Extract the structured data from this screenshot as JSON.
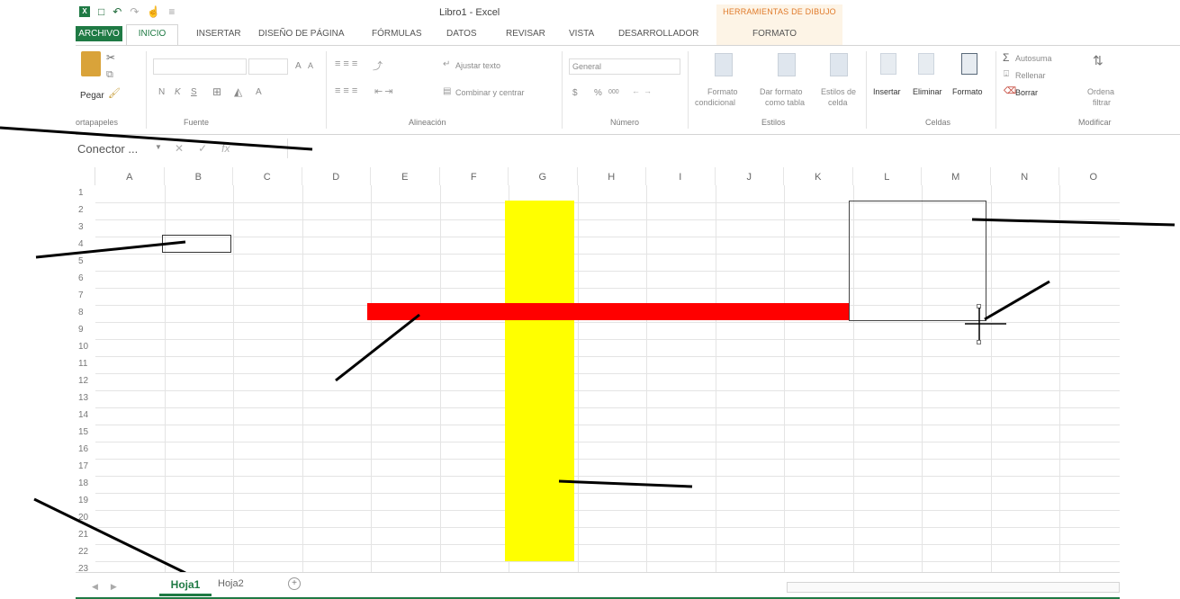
{
  "window": {
    "title": "Libro1 - Excel",
    "context_group": "HERRAMIENTAS DE DIBUJO"
  },
  "quick_access": [
    "excel-logo-icon",
    "save-icon",
    "undo-icon",
    "redo-icon",
    "touch-mode-icon",
    "customize-icon"
  ],
  "tabs": {
    "archivo": "ARCHIVO",
    "inicio": "INICIO",
    "insertar": "INSERTAR",
    "diseno": "DISEÑO DE PÁGINA",
    "formulas": "FÓRMULAS",
    "datos": "DATOS",
    "revisar": "REVISAR",
    "vista": "VISTA",
    "desarrollador": "DESARROLLADOR",
    "formato": "FORMATO"
  },
  "ribbon": {
    "clipboard": {
      "paste": "Pegar",
      "label": "ortapapeles"
    },
    "font": {
      "bold": "N",
      "italic": "K",
      "underline": "S",
      "grow": "A",
      "shrink": "A",
      "color": "A",
      "label": "Fuente"
    },
    "alignment": {
      "wrap": "Ajustar texto",
      "merge": "Combinar y centrar",
      "label": "Alineación"
    },
    "number": {
      "format": "General",
      "currency": "$",
      "percent": "%",
      "thousands": "000",
      "label": "Número"
    },
    "styles": {
      "conditional_1": "Formato",
      "conditional_2": "condicional",
      "table_1": "Dar formato",
      "table_2": "como tabla",
      "cell_1": "Estilos de",
      "cell_2": "celda",
      "label": "Estilos"
    },
    "cells": {
      "insert": "Insertar",
      "delete": "Eliminar",
      "format": "Formato",
      "label": "Celdas"
    },
    "editing": {
      "autosum": "Autosuma",
      "fill": "Rellenar",
      "clear": "Borrar",
      "sort_1": "Ordena",
      "sort_2": "filtrar",
      "label": "Modificar"
    }
  },
  "formula_bar": {
    "name_box": "Conector ...",
    "cancel": "✕",
    "enter": "✓",
    "fx": "fx"
  },
  "columns": [
    "A",
    "B",
    "C",
    "D",
    "E",
    "F",
    "G",
    "H",
    "I",
    "J",
    "K",
    "L",
    "M",
    "N",
    "O"
  ],
  "rows": [
    "1",
    "2",
    "3",
    "4",
    "5",
    "6",
    "7",
    "8",
    "9",
    "10",
    "11",
    "12",
    "13",
    "14",
    "15",
    "16",
    "17",
    "18",
    "19",
    "20",
    "21",
    "22",
    "23"
  ],
  "sheets": {
    "active": "Hoja1",
    "other": "Hoja2",
    "add": "+"
  },
  "colors": {
    "accent": "#1f7a44",
    "yellow_shape": "#ffff00",
    "red_shape": "#ff0000",
    "annotation_lines": "#000000"
  },
  "shapes": [
    {
      "type": "rectangle",
      "fill": "yellow",
      "spans_columns": "G",
      "spans_rows": "2-22"
    },
    {
      "type": "rectangle",
      "fill": "red",
      "spans_columns": "E-K",
      "spans_rows": "8"
    },
    {
      "type": "rectangle",
      "fill": "none",
      "spans_columns": "L-M",
      "spans_rows": "2-8",
      "selected": true
    },
    {
      "type": "cell-outline",
      "cell": "B4"
    }
  ]
}
